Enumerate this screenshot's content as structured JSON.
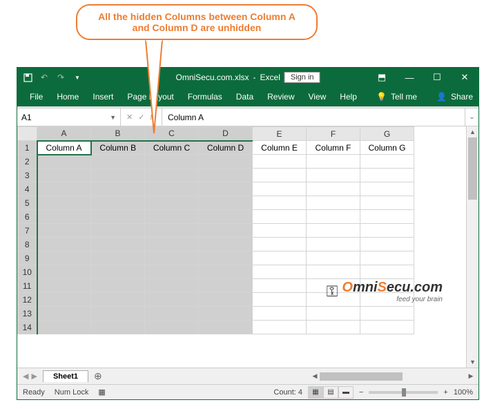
{
  "callout": {
    "text": "All the hidden Columns between  Column A and Column D are unhidden"
  },
  "titlebar": {
    "doc": "OmniSecu.com.xlsx",
    "app": "Excel",
    "signin": "Sign in"
  },
  "ribbon": {
    "tabs": [
      "File",
      "Home",
      "Insert",
      "Page Layout",
      "Formulas",
      "Data",
      "Review",
      "View",
      "Help"
    ],
    "tellme": "Tell me",
    "share": "Share"
  },
  "formula": {
    "namebox": "A1",
    "fx": "fx",
    "value": "Column A"
  },
  "grid": {
    "cols": [
      "A",
      "B",
      "C",
      "D",
      "E",
      "F",
      "G"
    ],
    "rows": [
      "1",
      "2",
      "3",
      "4",
      "5",
      "6",
      "7",
      "8",
      "9",
      "10",
      "11",
      "12",
      "13",
      "14"
    ],
    "header_values": [
      "Column A",
      "Column B",
      "Column  C",
      "Column D",
      "Column E",
      "Column F",
      "Column G"
    ],
    "selected_cols": 4,
    "active_cell": "A1"
  },
  "logo": {
    "brand1": "O",
    "brand2": "mni",
    "brand3": "S",
    "brand4": "ecu.com",
    "sub": "feed your brain"
  },
  "sheets": {
    "active": "Sheet1"
  },
  "status": {
    "ready": "Ready",
    "numlock": "Num Lock",
    "count": "Count: 4",
    "zoom": "100%"
  }
}
